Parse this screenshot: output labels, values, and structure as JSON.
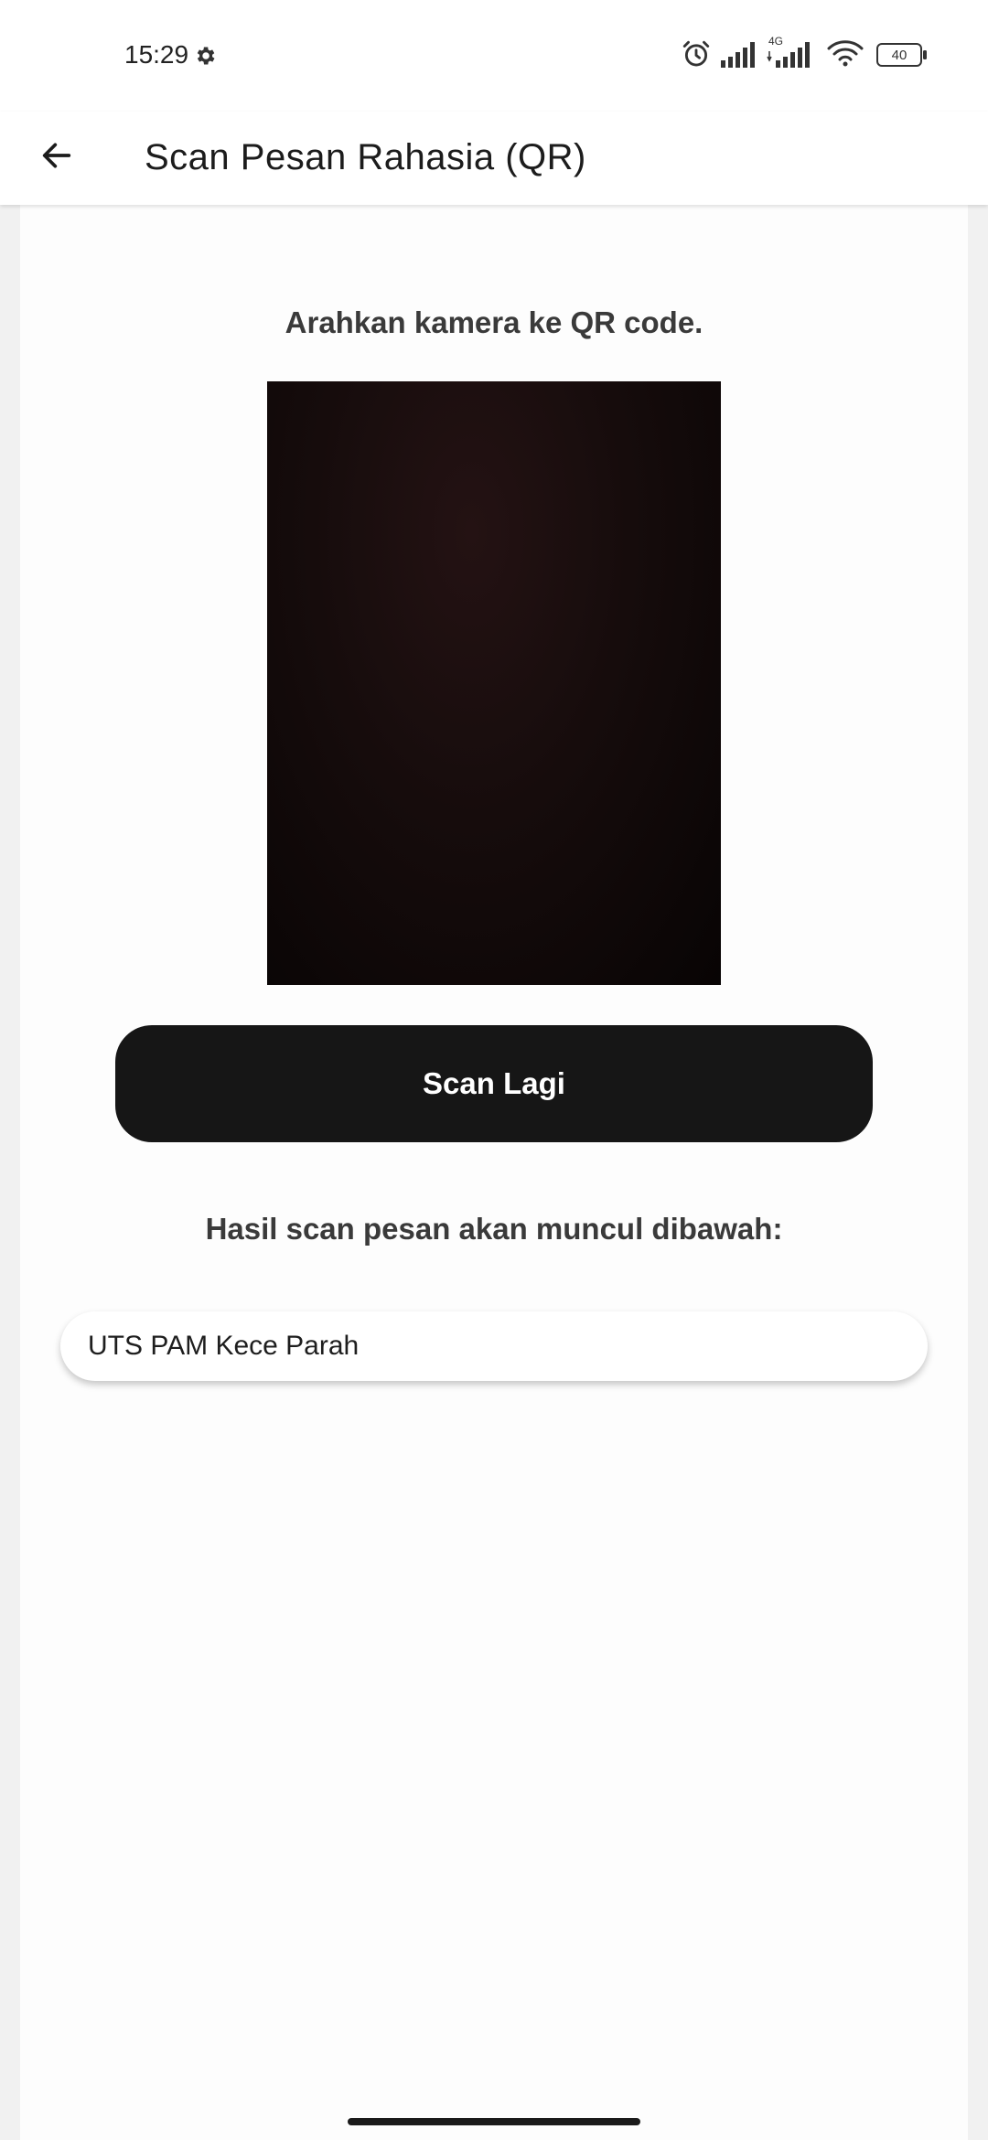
{
  "status": {
    "time": "15:29",
    "network_type": "4G",
    "battery": "40"
  },
  "app_bar": {
    "title": "Scan Pesan Rahasia (QR)"
  },
  "main": {
    "instruction": "Arahkan kamera ke QR code.",
    "scan_button_label": "Scan Lagi",
    "result_label": "Hasil scan pesan akan muncul dibawah:",
    "result_value": "UTS PAM Kece Parah"
  },
  "colors": {
    "button": "#161616",
    "camera_preview": "#160c0c",
    "background": "#fdfdfd"
  }
}
